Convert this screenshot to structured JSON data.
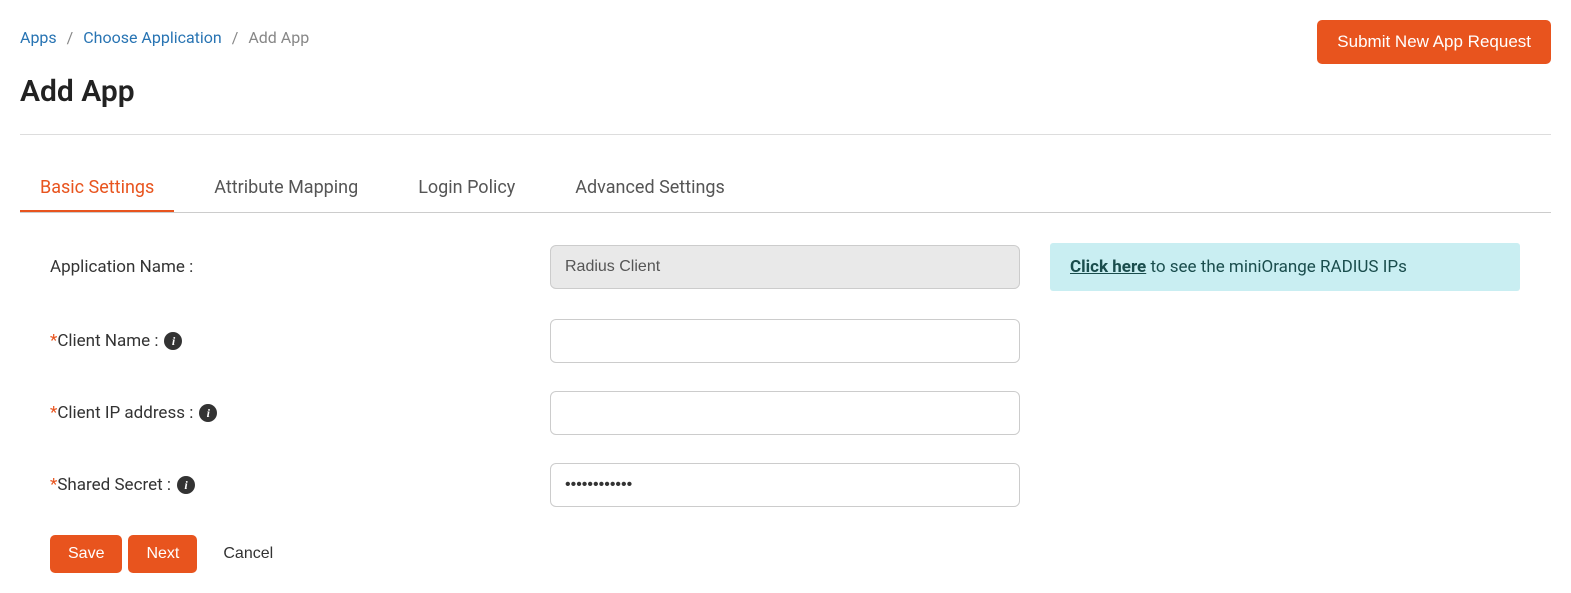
{
  "breadcrumb": {
    "apps": "Apps",
    "choose": "Choose Application",
    "current": "Add App"
  },
  "header": {
    "submitBtn": "Submit New App Request",
    "title": "Add App"
  },
  "tabs": {
    "basic": "Basic Settings",
    "attribute": "Attribute Mapping",
    "login": "Login Policy",
    "advanced": "Advanced Settings"
  },
  "form": {
    "appName": {
      "label": "Application Name :",
      "value": "Radius Client"
    },
    "clientName": {
      "label": "Client Name :",
      "value": ""
    },
    "clientIp": {
      "label": "Client IP address :",
      "value": ""
    },
    "sharedSecret": {
      "label": "Shared Secret :",
      "value": "••••••••••••"
    }
  },
  "infoBox": {
    "link": "Click here",
    "text": " to see the miniOrange RADIUS IPs"
  },
  "buttons": {
    "save": "Save",
    "next": "Next",
    "cancel": "Cancel"
  }
}
